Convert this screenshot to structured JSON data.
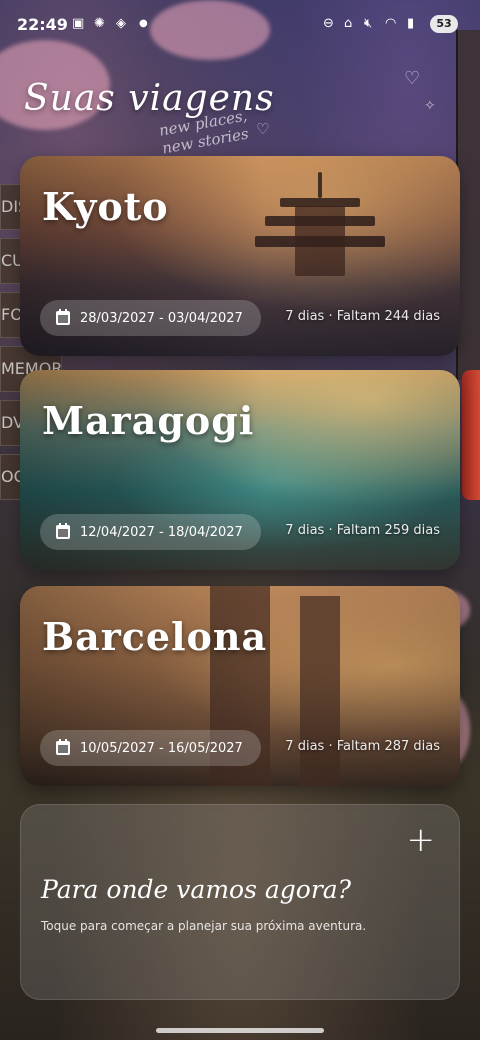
{
  "status_bar": {
    "time": "22:49",
    "left_icons": [
      "screenshot-icon",
      "openai-icon",
      "ai-icon",
      "dot-icon"
    ],
    "right_icons": [
      "dnd-icon",
      "sleep-icon",
      "mute-icon",
      "wifi-icon",
      "signal-icon"
    ],
    "battery": "53"
  },
  "header": {
    "title": "Suas viagens",
    "doodle_line1": "new places,",
    "doodle_line2": "new stories"
  },
  "trips": [
    {
      "city": "Kyoto",
      "dates": "28/03/2027 - 03/04/2027",
      "duration": "7 dias",
      "countdown": "Faltam 244 dias"
    },
    {
      "city": "Maragogi",
      "dates": "12/04/2027 - 18/04/2027",
      "duration": "7 dias",
      "countdown": "Faltam 259 dias"
    },
    {
      "city": "Barcelona",
      "dates": "10/05/2027 - 16/05/2027",
      "duration": "7 dias",
      "countdown": "Faltam 287 dias"
    }
  ],
  "new_trip": {
    "plus": "+",
    "title": "Para onde vamos agora?",
    "subtitle": "Toque para começar a planejar sua próxima aventura."
  },
  "background_signs": [
    "DIS",
    "CU",
    "FO",
    "MEMORIES",
    "DV",
    "OO"
  ]
}
